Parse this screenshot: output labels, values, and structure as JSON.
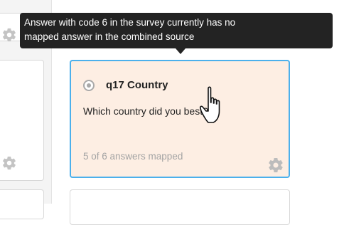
{
  "tooltip": {
    "line1": "Answer with code 6 in the survey currently has no",
    "line2": "mapped answer in the combined source"
  },
  "question_card": {
    "code": "q17 Country",
    "text": "Which country did you         best?",
    "status": "5 of 6 answers mapped",
    "mapped_count": 5,
    "total_count": 6,
    "selected": false
  },
  "icons": {
    "settings": "gear-icon",
    "radio": "radio-icon",
    "cursor": "hand-pointer-cursor"
  },
  "colors": {
    "card_background": "#fdeee3",
    "card_border_active": "#4bb0ec",
    "tooltip_background": "#232323",
    "status_text": "#a4a4a4"
  }
}
